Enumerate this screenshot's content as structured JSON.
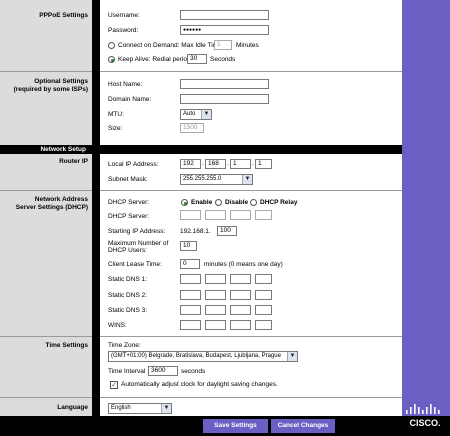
{
  "pppoe": {
    "section_title": "PPPoE Settings",
    "username_label": "Username:",
    "username_value": "",
    "password_label": "Password:",
    "password_value": "●●●●●●",
    "connect_on_demand_label": "Connect on Demand: Max Idle Time",
    "max_idle_value": "1",
    "minutes_label": "Minutes",
    "keep_alive_label": "Keep Alive: Redial period",
    "redial_value": "30",
    "seconds_label": "Seconds"
  },
  "optional": {
    "section_title": "Optional Settings",
    "section_subtitle": "(required by some ISPs)",
    "host_name_label": "Host Name:",
    "host_name_value": "",
    "domain_name_label": "Domain Name:",
    "domain_name_value": "",
    "mtu_label": "MTU:",
    "mtu_value": "Auto",
    "size_label": "Size:",
    "size_value": "1500"
  },
  "network_setup": {
    "title": "Network Setup",
    "router_ip_title": "Router IP",
    "local_ip_label": "Local IP Address:",
    "local_ip": [
      "192",
      "168",
      "1",
      "1"
    ],
    "subnet_label": "Subnet Mask:",
    "subnet_value": "255.255.255.0"
  },
  "dhcp": {
    "section_title_1": "Network Address",
    "section_title_2": "Server Settings (DHCP)",
    "server_label": "DHCP Server:",
    "enable_label": "Enable",
    "disable_label": "Disable",
    "relay_label": "DHCP Relay",
    "dhcp_server_label": "DHCP Server:",
    "starting_ip_label": "Starting IP Address:",
    "starting_ip_prefix": "192.168.1.",
    "starting_ip_value": "100",
    "max_users_label_1": "Maximum Number of",
    "max_users_label_2": "DHCP Users:",
    "max_users_value": "10",
    "lease_label": "Client Lease Time:",
    "lease_value": "0",
    "lease_suffix": "minutes (0 means one day)",
    "dns1_label": "Static DNS 1:",
    "dns2_label": "Static DNS 2:",
    "dns3_label": "Static DNS 3:",
    "wins_label": "WINS:"
  },
  "time": {
    "section_title": "Time Settings",
    "zone_label": "Time Zone:",
    "zone_value": "(GMT+01:00) Belgrade, Bratislava, Budapest, Ljubljana, Prague",
    "interval_label": "Time Interval :",
    "interval_value": "3600",
    "interval_suffix": "seconds",
    "daylight_label": "Automatically adjust clock for daylight saving changes."
  },
  "language": {
    "section_title": "Language",
    "value": "English"
  },
  "footer": {
    "save_label": "Save Settings",
    "cancel_label": "Cancel Changes",
    "brand": "CISCO.",
    "brand_color": "#ffffff"
  },
  "colors": {
    "accent": "#6a5fc3",
    "left_panel": "#dcdcdc",
    "bar": "#000000"
  }
}
